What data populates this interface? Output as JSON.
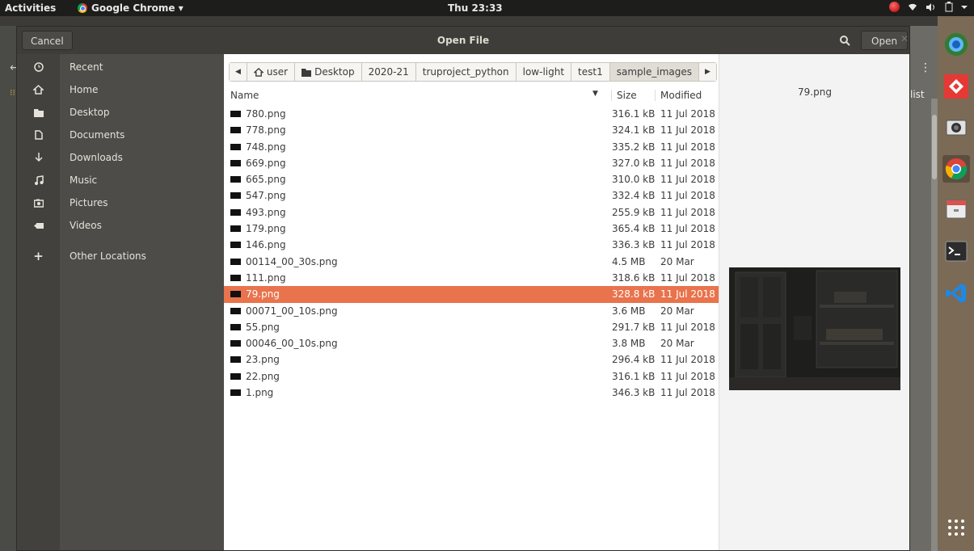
{
  "topbar": {
    "activities": "Activities",
    "app_name": "Google Chrome ▾",
    "clock": "Thu 23:33",
    "sys_icons": [
      "record-icon",
      "wifi-icon",
      "volume-icon",
      "battery-icon",
      "system-menu-icon"
    ]
  },
  "background_window": {
    "right_label": "list",
    "menu_dots": "⋮"
  },
  "dialog": {
    "cancel_label": "Cancel",
    "title": "Open File",
    "open_label": "Open"
  },
  "sidebar": {
    "items": [
      {
        "label": "Recent",
        "icon": "clock-icon"
      },
      {
        "label": "Home",
        "icon": "home-icon"
      },
      {
        "label": "Desktop",
        "icon": "folder-icon"
      },
      {
        "label": "Documents",
        "icon": "document-icon"
      },
      {
        "label": "Downloads",
        "icon": "download-icon"
      },
      {
        "label": "Music",
        "icon": "music-icon"
      },
      {
        "label": "Pictures",
        "icon": "camera-icon"
      },
      {
        "label": "Videos",
        "icon": "video-icon"
      },
      {
        "label": "Other Locations",
        "icon": "plus-icon"
      }
    ]
  },
  "pathbar": {
    "crumbs": [
      "user",
      "Desktop",
      "2020-21",
      "truproject_python",
      "low-light",
      "test1",
      "sample_images"
    ]
  },
  "columns": {
    "name": "Name",
    "size": "Size",
    "modified": "Modified"
  },
  "files": [
    {
      "name": "780.png",
      "size": "316.1 kB",
      "modified": "11 Jul 2018"
    },
    {
      "name": "778.png",
      "size": "324.1 kB",
      "modified": "11 Jul 2018"
    },
    {
      "name": "748.png",
      "size": "335.2 kB",
      "modified": "11 Jul 2018"
    },
    {
      "name": "669.png",
      "size": "327.0 kB",
      "modified": "11 Jul 2018"
    },
    {
      "name": "665.png",
      "size": "310.0 kB",
      "modified": "11 Jul 2018"
    },
    {
      "name": "547.png",
      "size": "332.4 kB",
      "modified": "11 Jul 2018"
    },
    {
      "name": "493.png",
      "size": "255.9 kB",
      "modified": "11 Jul 2018"
    },
    {
      "name": "179.png",
      "size": "365.4 kB",
      "modified": "11 Jul 2018"
    },
    {
      "name": "146.png",
      "size": "336.3 kB",
      "modified": "11 Jul 2018"
    },
    {
      "name": "00114_00_30s.png",
      "size": "4.5 MB",
      "modified": "20 Mar"
    },
    {
      "name": "111.png",
      "size": "318.6 kB",
      "modified": "11 Jul 2018"
    },
    {
      "name": "79.png",
      "size": "328.8 kB",
      "modified": "11 Jul 2018",
      "selected": true
    },
    {
      "name": "00071_00_10s.png",
      "size": "3.6 MB",
      "modified": "20 Mar"
    },
    {
      "name": "55.png",
      "size": "291.7 kB",
      "modified": "11 Jul 2018"
    },
    {
      "name": "00046_00_10s.png",
      "size": "3.8 MB",
      "modified": "20 Mar"
    },
    {
      "name": "23.png",
      "size": "296.4 kB",
      "modified": "11 Jul 2018"
    },
    {
      "name": "22.png",
      "size": "316.1 kB",
      "modified": "11 Jul 2018"
    },
    {
      "name": "1.png",
      "size": "346.3 kB",
      "modified": "11 Jul 2018"
    }
  ],
  "preview": {
    "filename": "79.png"
  },
  "colors": {
    "selection": "#e9734c",
    "sidebar_bg": "#4d4c48",
    "titlebar_bg": "#3e3d39"
  }
}
